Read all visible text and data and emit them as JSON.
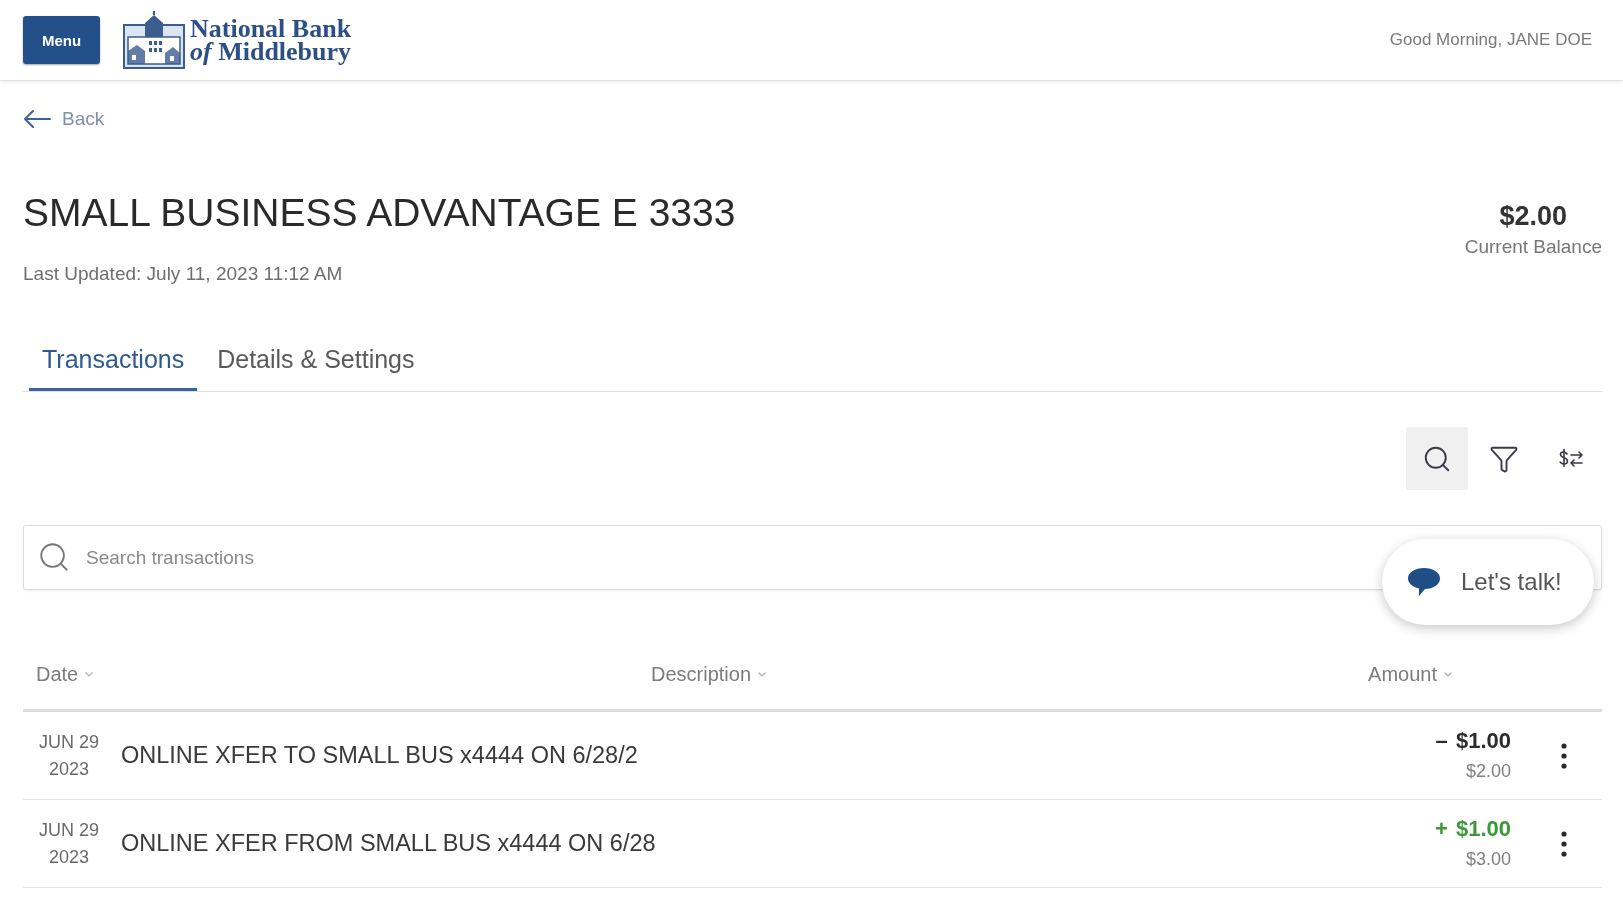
{
  "header": {
    "menu_button": "Menu",
    "bank_name": [
      "National Bank",
      "*of* Middlebury"
    ],
    "greeting": "Good Morning, JANE DOE"
  },
  "back_link": "Back",
  "account": {
    "title": "SMALL BUSINESS ADVANTAGE E 3333",
    "last_updated": "Last Updated: July 11, 2023 11:12 AM",
    "balance": "$2.00",
    "balance_label": "Current Balance"
  },
  "tabs": [
    {
      "label": "Transactions",
      "selected": true
    },
    {
      "label": "Details & Settings",
      "selected": false
    }
  ],
  "toolbar": [
    {
      "kind": "search",
      "active": true
    },
    {
      "kind": "filter",
      "active": false
    },
    {
      "kind": "sort",
      "active": false
    }
  ],
  "search": {
    "placeholder": "Search transactions"
  },
  "chat_button": "Let's talk!",
  "table": {
    "columns": [
      "Date",
      "Description",
      "Amount"
    ],
    "rows": [
      {
        "date": "JUN 29",
        "year": "2023",
        "description": "ONLINE XFER TO SMALL BUS x4444 ON 6/28/2",
        "kind": "debit",
        "amount": "– $1.00",
        "balance": "$2.00"
      },
      {
        "date": "JUN 29",
        "year": "2023",
        "description": "ONLINE XFER FROM SMALL BUS x4444 ON 6/28",
        "kind": "credit",
        "amount": "+ $1.00",
        "balance": "$3.00"
      }
    ]
  }
}
